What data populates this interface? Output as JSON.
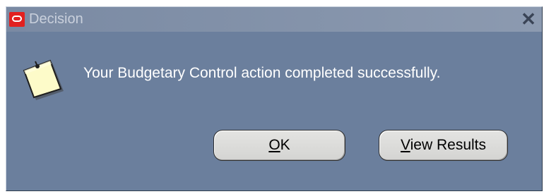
{
  "window": {
    "title": "Decision",
    "close_icon": "close-icon"
  },
  "dialog": {
    "icon": "note-icon",
    "message": "Your Budgetary Control action completed successfully."
  },
  "buttons": {
    "ok": {
      "mnemonic": "O",
      "rest": "K"
    },
    "view_results": {
      "mnemonic": "V",
      "rest": "iew Results"
    }
  },
  "colors": {
    "dialog_bg": "#6b7f9d",
    "title_text": "#c9d0dc",
    "logo_red": "#e2201f",
    "button_face": "#d8d8d6"
  }
}
